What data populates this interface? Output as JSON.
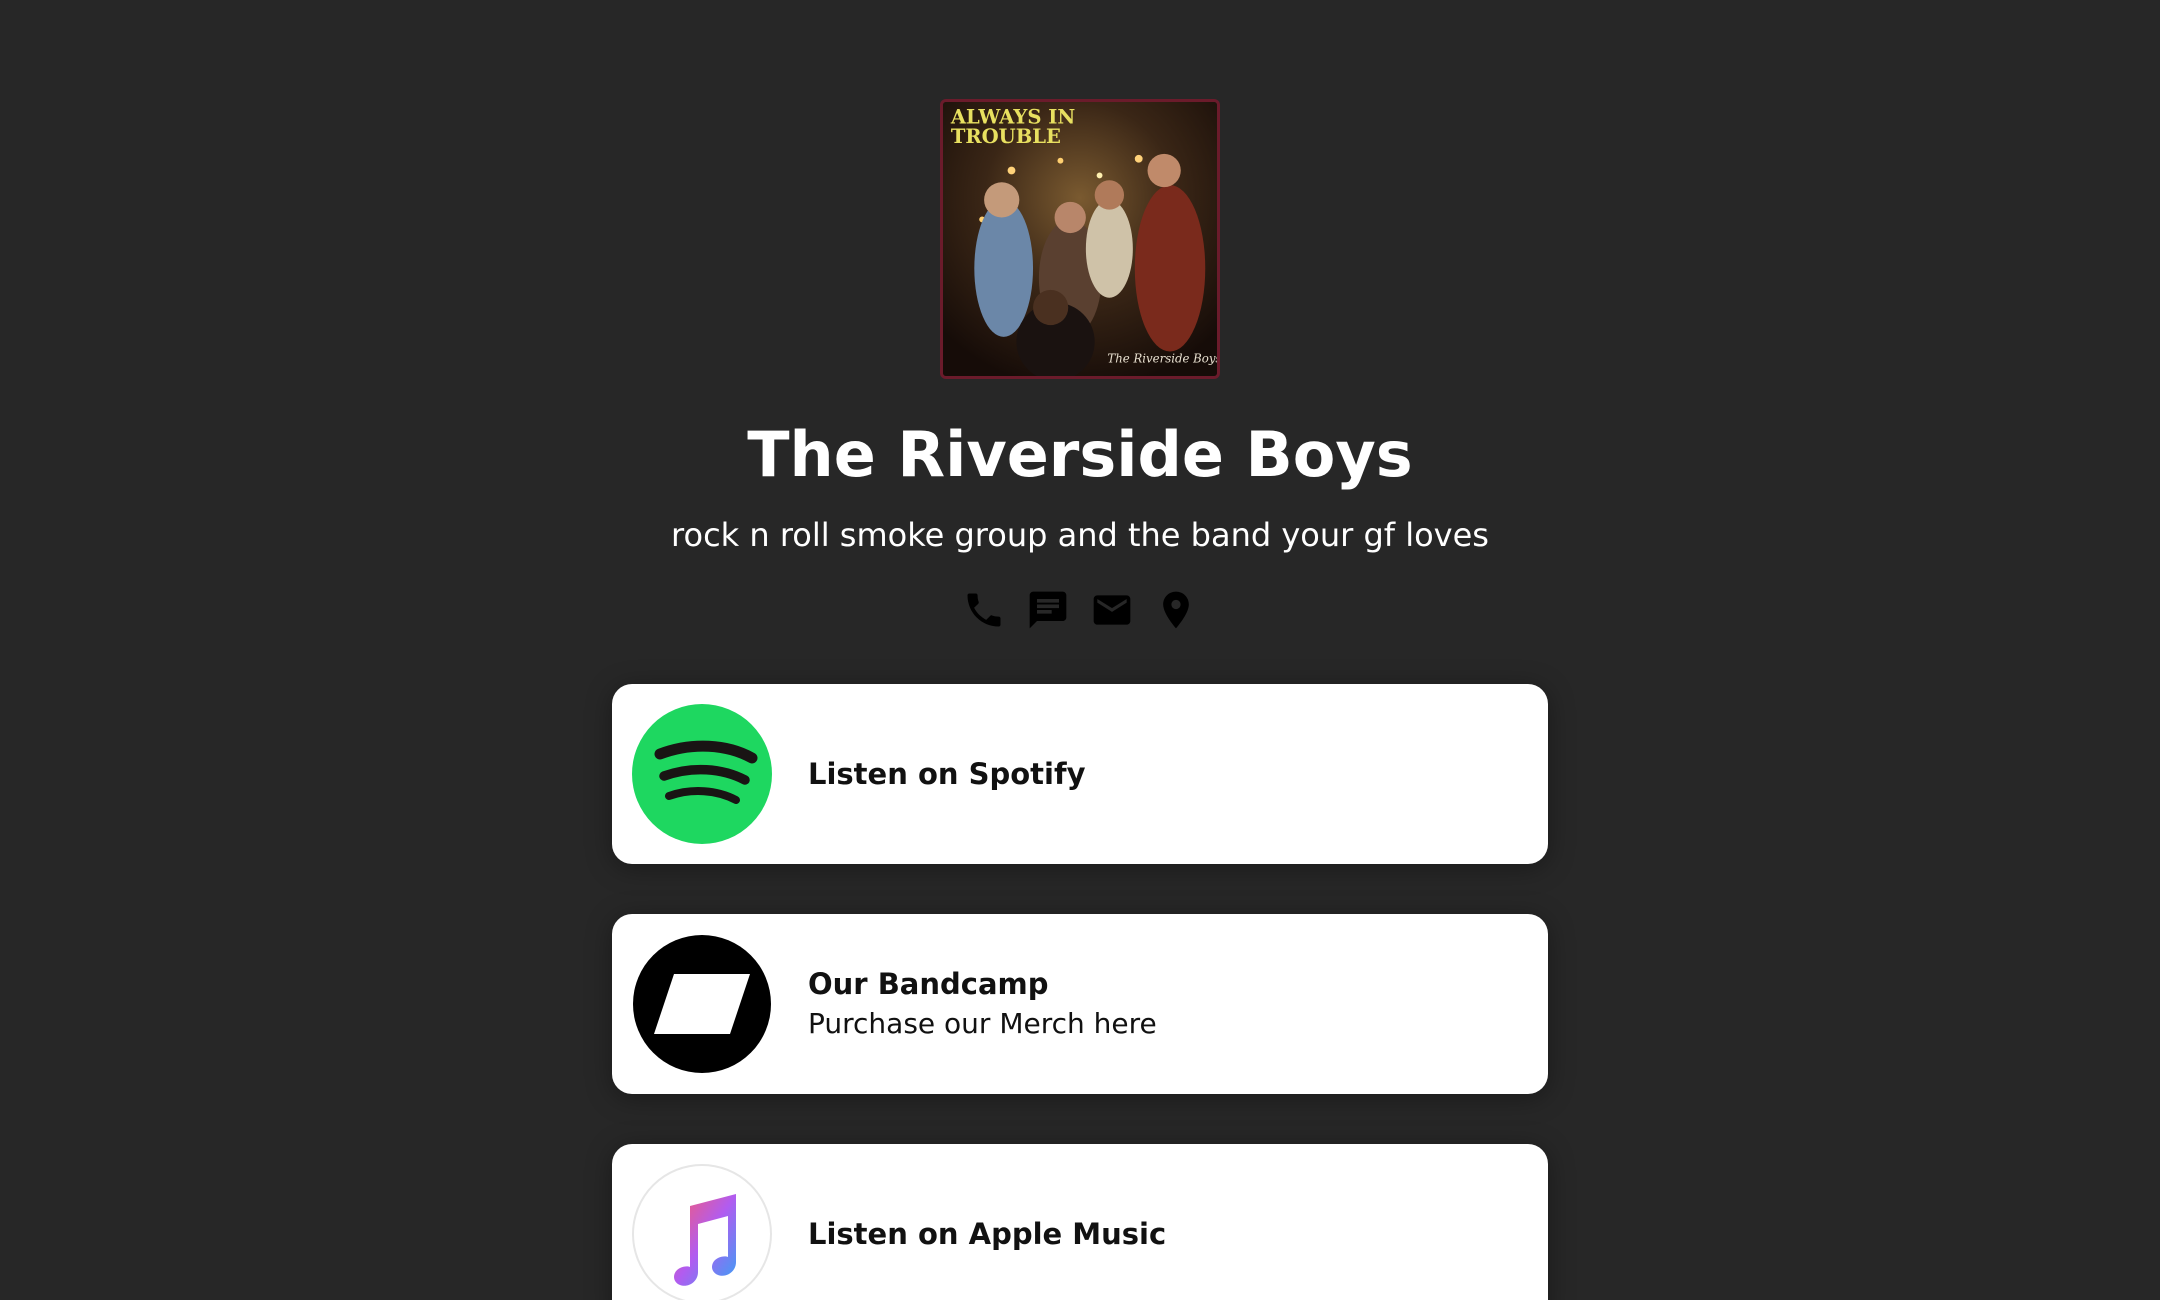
{
  "profile": {
    "name": "The Riverside Boys",
    "bio": "rock n roll smoke group and the band your gf loves",
    "avatar": {
      "icon": "album-cover-image",
      "cover_text_top_line1": "ALWAYS IN",
      "cover_text_top_line2": "TROUBLE",
      "cover_signature": "The Riverside Boys"
    }
  },
  "contacts": [
    {
      "icon": "phone-icon"
    },
    {
      "icon": "message-icon"
    },
    {
      "icon": "email-icon"
    },
    {
      "icon": "location-pin-icon"
    }
  ],
  "links": [
    {
      "title": "Listen on Spotify",
      "subtitle": "",
      "icon": "spotify-icon"
    },
    {
      "title": "Our Bandcamp",
      "subtitle": "Purchase our Merch here",
      "icon": "bandcamp-icon"
    },
    {
      "title": "Listen on Apple Music",
      "subtitle": "",
      "icon": "apple-music-icon"
    }
  ],
  "colors": {
    "background": "#272727",
    "card": "#ffffff",
    "spotify_green": "#1ED760",
    "avatar_border": "#6b1b2b"
  }
}
